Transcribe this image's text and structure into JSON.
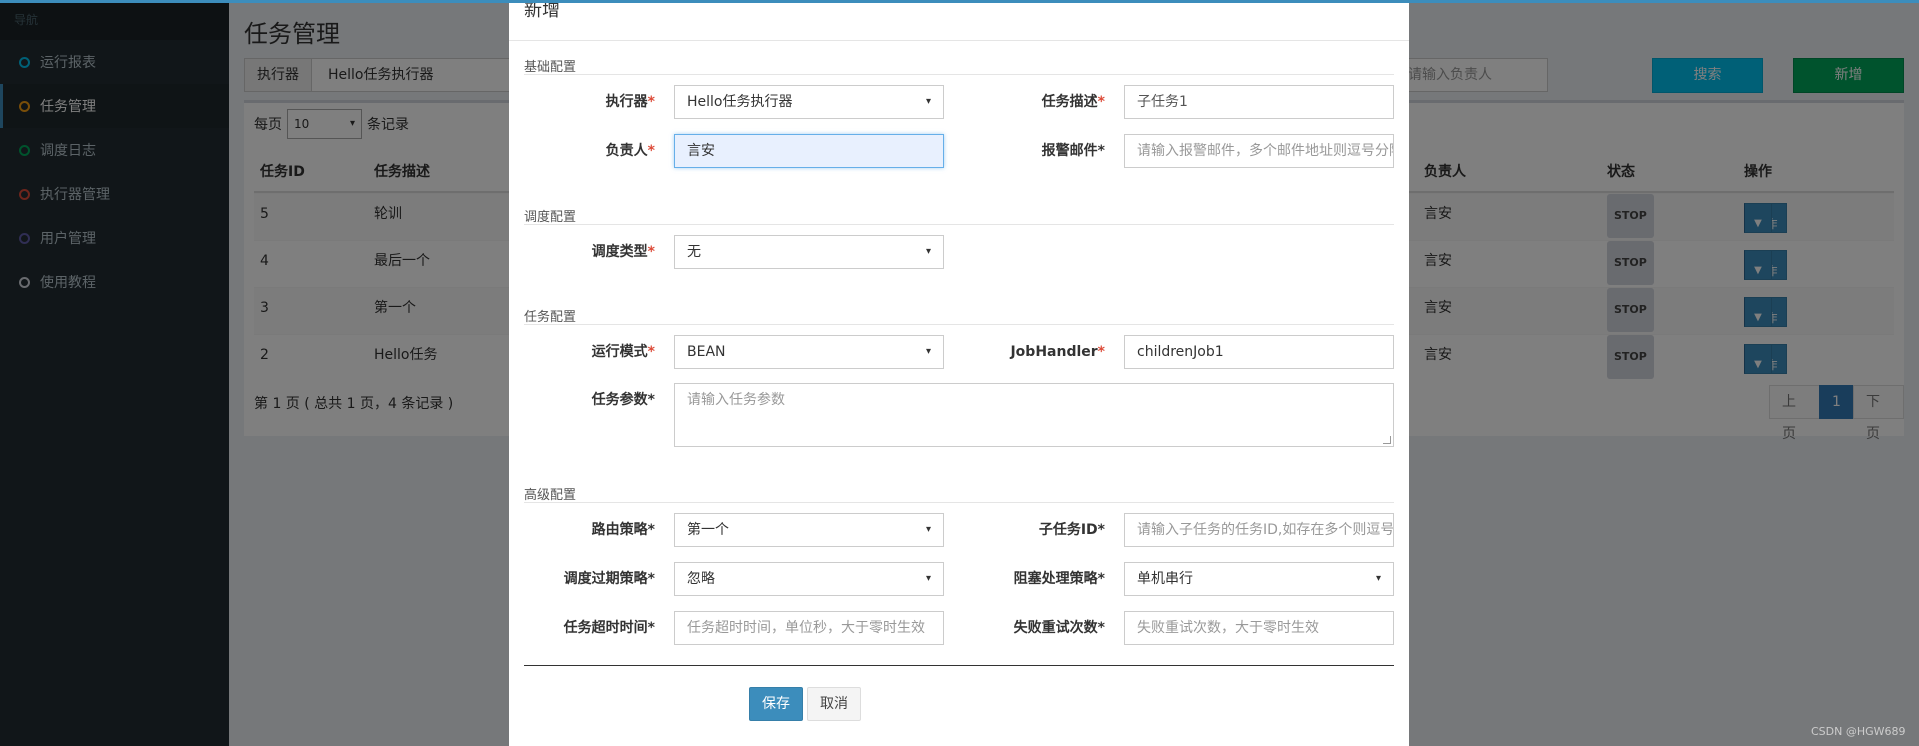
{
  "sidebar": {
    "header": "导航",
    "items": [
      {
        "label": "运行报表",
        "color": "#00c0ef"
      },
      {
        "label": "任务管理",
        "color": "#f39c12"
      },
      {
        "label": "调度日志",
        "color": "#00a65a"
      },
      {
        "label": "执行器管理",
        "color": "#dd4b39"
      },
      {
        "label": "用户管理",
        "color": "#605ca8"
      },
      {
        "label": "使用教程",
        "color": "#d2d6de"
      }
    ]
  },
  "main": {
    "title": "任务管理",
    "filter": {
      "addon": "执行器",
      "value": "Hello任务执行器",
      "author_placeholder": "请输入负责人"
    },
    "search_label": "搜索",
    "add_label": "新增",
    "length": {
      "prefix": "每页",
      "value": "10",
      "suffix": "条记录"
    },
    "columns": [
      "任务ID",
      "任务描述",
      "负责人",
      "状态",
      "操作"
    ],
    "rows": [
      {
        "id": "5",
        "desc": "轮训",
        "author": "言安",
        "status": "STOP",
        "op": "操作"
      },
      {
        "id": "4",
        "desc": "最后一个",
        "author": "言安",
        "status": "STOP",
        "op": "操作"
      },
      {
        "id": "3",
        "desc": "第一个",
        "author": "言安",
        "status": "STOP",
        "op": "操作"
      },
      {
        "id": "2",
        "desc": "Hello任务",
        "author": "言安",
        "status": "STOP",
        "op": "操作"
      }
    ],
    "info": "第 1 页 ( 总共 1 页，4 条记录 )",
    "pager": {
      "prev": "上页",
      "current": "1",
      "next": "下页"
    }
  },
  "modal": {
    "title": "新增",
    "sections": {
      "basic": "基础配置",
      "schedule": "调度配置",
      "task": "任务配置",
      "advanced": "高级配置"
    },
    "fields": {
      "executor": {
        "label": "执行器",
        "value": "Hello任务执行器"
      },
      "desc": {
        "label": "任务描述",
        "value": "子任务1"
      },
      "author": {
        "label": "负责人",
        "value": "言安"
      },
      "alarm": {
        "label": "报警邮件",
        "placeholder": "请输入报警邮件，多个邮件地址则逗号分隔"
      },
      "schedule_type": {
        "label": "调度类型",
        "value": "无"
      },
      "glue_type": {
        "label": "运行模式",
        "value": "BEAN"
      },
      "handler": {
        "label": "JobHandler",
        "value": "childrenJob1"
      },
      "param": {
        "label": "任务参数",
        "placeholder": "请输入任务参数"
      },
      "route": {
        "label": "路由策略",
        "value": "第一个"
      },
      "child": {
        "label": "子任务ID",
        "placeholder": "请输入子任务的任务ID,如存在多个则逗号分隔"
      },
      "misfire": {
        "label": "调度过期策略",
        "value": "忽略"
      },
      "block": {
        "label": "阻塞处理策略",
        "value": "单机串行"
      },
      "timeout": {
        "label": "任务超时时间",
        "placeholder": "任务超时时间，单位秒，大于零时生效"
      },
      "retry": {
        "label": "失败重试次数",
        "placeholder": "失败重试次数，大于零时生效"
      }
    },
    "save_label": "保存",
    "cancel_label": "取消"
  },
  "watermark": "CSDN @HGW689",
  "colors": {
    "primary": "#3c8dbc",
    "info": "#00c0ef",
    "success": "#00a65a",
    "sidebar": "#222d32",
    "required": "#dd4b39"
  }
}
